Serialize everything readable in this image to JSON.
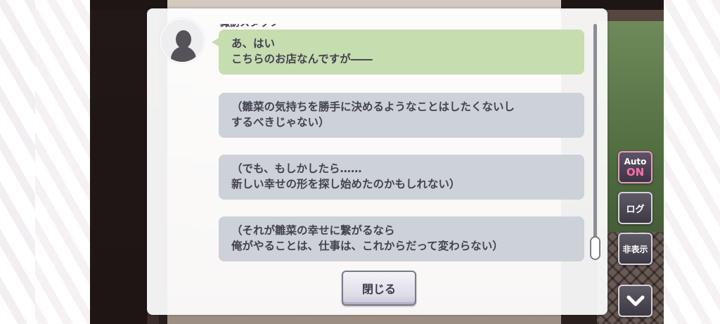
{
  "speaker": {
    "name": "諏訪スタッフ"
  },
  "dialogue_entries": [
    {
      "type": "dialogue",
      "text": "あ、はい\nこちらのお店なんですが――"
    },
    {
      "type": "monologue",
      "text": "（雛菜の気持ちを勝手に決めるようなことはしたくないし\nするべきじゃない）"
    },
    {
      "type": "monologue",
      "text": "（でも、もしかしたら……\n新しい幸せの形を探し始めたのかもしれない）"
    },
    {
      "type": "monologue",
      "text": "（それが雛菜の幸せに繋がるなら\n俺がやることは、仕事は、これからだって変わらない）"
    }
  ],
  "buttons": {
    "close_label": "閉じる"
  },
  "controls": {
    "auto_label": "Auto",
    "auto_state": "ON",
    "log_label": "ログ",
    "hide_label": "非表示",
    "down_icon": "chevron-down-icon"
  },
  "colors": {
    "dialogue_bubble": "#c6ddb0",
    "monologue_bubble": "#cdd1d8",
    "auto_on_accent": "#ff6fa6"
  }
}
